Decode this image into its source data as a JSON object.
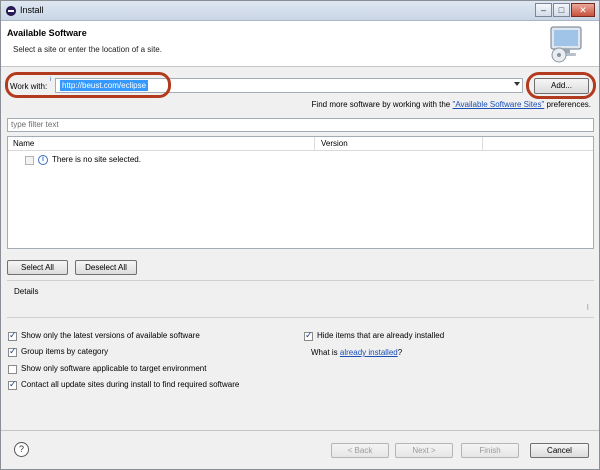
{
  "window": {
    "title": "Install",
    "buttons": [
      "–",
      "□",
      "✕"
    ]
  },
  "banner": {
    "title": "Available Software",
    "subtitle": "Select a site or enter the location of a site.",
    "icon": "computer-install-icon"
  },
  "work_with": {
    "label": "Work with:",
    "info": "i",
    "value": "http://beust.com/eclipse",
    "add_label": "Add..."
  },
  "find_more": {
    "prefix": "Find more software by working with the ",
    "link": "\"Available Software Sites\"",
    "suffix": " preferences."
  },
  "filter": {
    "placeholder": "type filter text"
  },
  "table": {
    "columns": [
      "Name",
      "Version"
    ],
    "rows": [
      {
        "checked": false,
        "icon": "info-icon",
        "text": "There is no site selected."
      }
    ]
  },
  "buttons": {
    "select_all": "Select All",
    "deselect_all": "Deselect All"
  },
  "details": {
    "label": "Details",
    "scroll_glyph": "⁝"
  },
  "options": {
    "latest_versions": "Show only the latest versions of available software",
    "group_by_category": "Group items by category",
    "target_env": "Show only software applicable to target environment",
    "contact_sites": "Contact all update sites during install to find required software",
    "hide_installed": "Hide items that are already installed",
    "what_is_prefix": "What is ",
    "what_is_link": "already installed",
    "what_is_suffix": "?"
  },
  "footer": {
    "help": "?",
    "back": "< Back",
    "next": "Next >",
    "finish": "Finish",
    "cancel": "Cancel"
  }
}
